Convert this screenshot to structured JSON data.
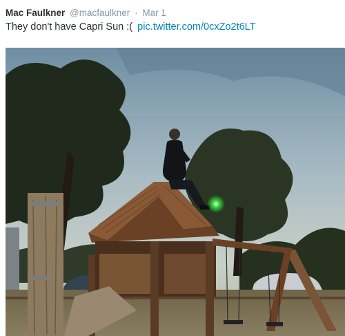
{
  "tweet": {
    "author_name": "Mac Faulkner",
    "author_handle": "@macfaulkner",
    "separator": "·",
    "date": "Mar 1",
    "text": "They don't have Capri Sun :(",
    "link": "pic.twitter.com/0cxZo2t6LT"
  },
  "media": {
    "kind": "photo",
    "subject": "man-sitting-on-playground-fort-roof"
  }
}
